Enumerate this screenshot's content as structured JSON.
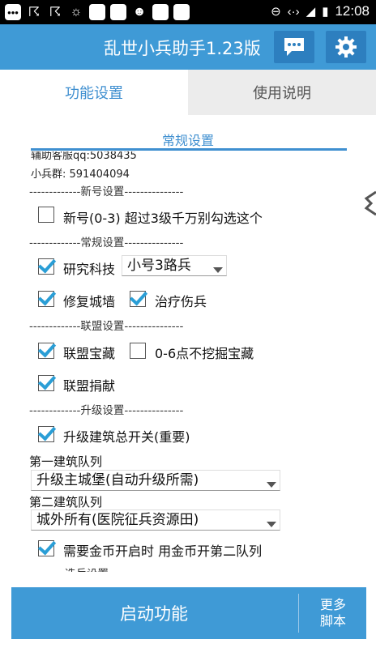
{
  "statusbar": {
    "time": "12:08",
    "icons": [
      "chat-bubble-icon",
      "uc-browser-icon",
      "uc-browser-icon",
      "brightness-icon",
      "app-icon",
      "app-icon",
      "face-icon",
      "app-icon",
      "app-icon",
      "minus-circle-icon",
      "data-transfer-icon",
      "signal-icon",
      "battery-icon"
    ]
  },
  "appbar": {
    "title": "乱世小兵助手1.23版",
    "color": "#3f9ad6"
  },
  "tabs": [
    {
      "label": "功能设置",
      "active": true
    },
    {
      "label": "使用说明",
      "active": false
    }
  ],
  "section": {
    "title": "常规设置",
    "accent": "#3f8fd0"
  },
  "content": {
    "support_qq": "辅助客服qq:5038435",
    "group": "小兵群: 591404094",
    "dividers": {
      "new": "-------------新号设置---------------",
      "regular": "-------------常规设置---------------",
      "alliance": "-------------联盟设置---------------",
      "upgrade": "-------------升级设置---------------",
      "troops": "---------选兵设置---------------"
    },
    "options": {
      "new_account": {
        "label": "新号(0-3) 超过3级千万别勾选这个",
        "checked": false
      },
      "research": {
        "label": "研究科技",
        "checked": true
      },
      "research_select": "小号3路兵",
      "repair_wall": {
        "label": "修复城墙",
        "checked": true
      },
      "heal": {
        "label": "治疗伤兵",
        "checked": true
      },
      "alliance_treasure": {
        "label": "联盟宝藏",
        "checked": true
      },
      "no_dig": {
        "label": "0-6点不挖掘宝藏",
        "checked": false
      },
      "alliance_donate": {
        "label": "联盟捐献",
        "checked": true
      },
      "upgrade_master": {
        "label": "升级建筑总开关(重要)",
        "checked": true
      },
      "queue1_label": "第一建筑队列",
      "queue1_select": "升级主城堡(自动升级所需)",
      "queue2_label": "第二建筑队列",
      "queue2_select": "城外所有(医院征兵资源田)",
      "gold_queue": {
        "label": "需要金币开启时 用金币开第二队列",
        "checked": true
      }
    }
  },
  "bottom": {
    "start_label": "启动功能",
    "more_line1": "更多",
    "more_line2": "脚本"
  }
}
